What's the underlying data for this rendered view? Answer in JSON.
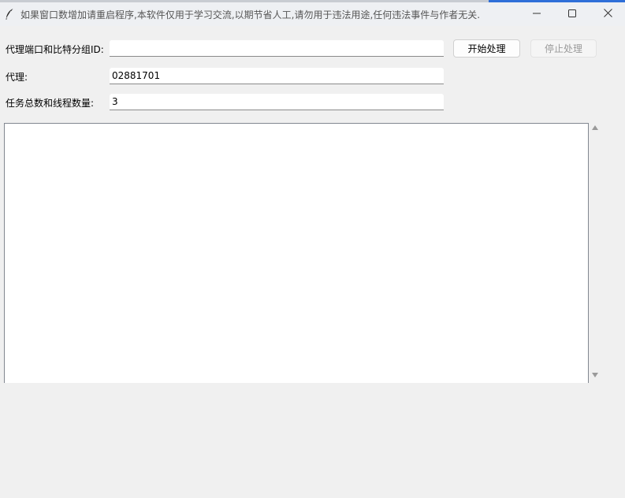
{
  "window": {
    "title": "如果窗口数增加请重启程序,本软件仅用于学习交流,以期节省人工,请勿用于违法用途,任何违法事件与作者无关.",
    "icon": "feather-icon",
    "controls": {
      "minimize_icon": "minimize-icon",
      "maximize_icon": "maximize-icon",
      "close_icon": "close-icon"
    }
  },
  "form": {
    "port_label": "代理端口和比特分组ID:",
    "port_value": "",
    "proxy_label": "代理:",
    "proxy_value": "02881701",
    "task_label": "任务总数和线程数量:",
    "task_value": "3"
  },
  "buttons": {
    "start_label": "开始处理",
    "stop_label": "停止处理"
  },
  "log": {
    "content": ""
  },
  "colors": {
    "window_bg": "#f0f0f0",
    "titlebar_bg": "#eef0f3",
    "accent": "#2f6fd8",
    "disabled_text": "#9a9a9a"
  }
}
